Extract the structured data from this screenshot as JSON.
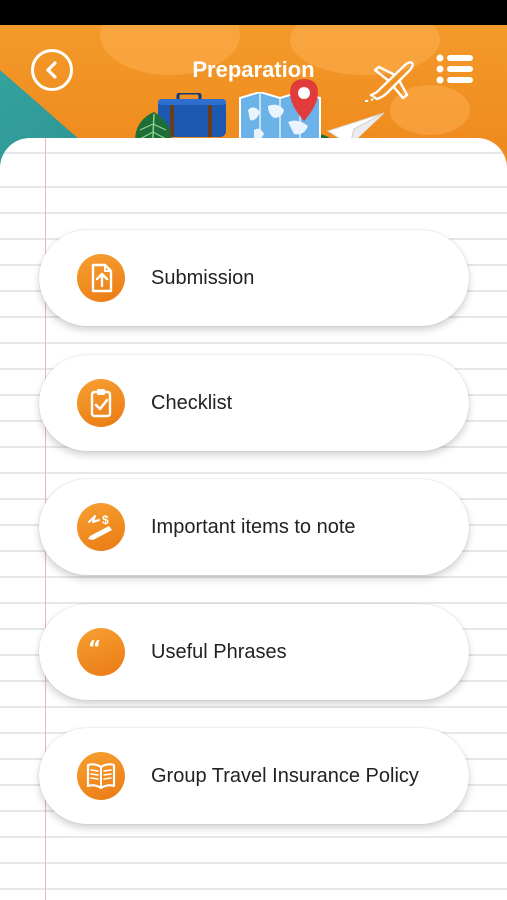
{
  "header": {
    "title": "Preparation",
    "back_icon": "chevron-left-icon",
    "menu_icon": "list-icon"
  },
  "menu": {
    "items": [
      {
        "label": "Submission",
        "icon": "upload-document-icon"
      },
      {
        "label": "Checklist",
        "icon": "clipboard-check-icon"
      },
      {
        "label": "Important items to note",
        "icon": "pen-money-icon"
      },
      {
        "label": "Useful Phrases",
        "icon": "quote-icon"
      },
      {
        "label": "Group Travel Insurance Policy",
        "icon": "open-book-icon"
      }
    ]
  },
  "colors": {
    "accent": "#f08a1e",
    "teal": "#2aa3a4",
    "card_text": "#222222"
  }
}
